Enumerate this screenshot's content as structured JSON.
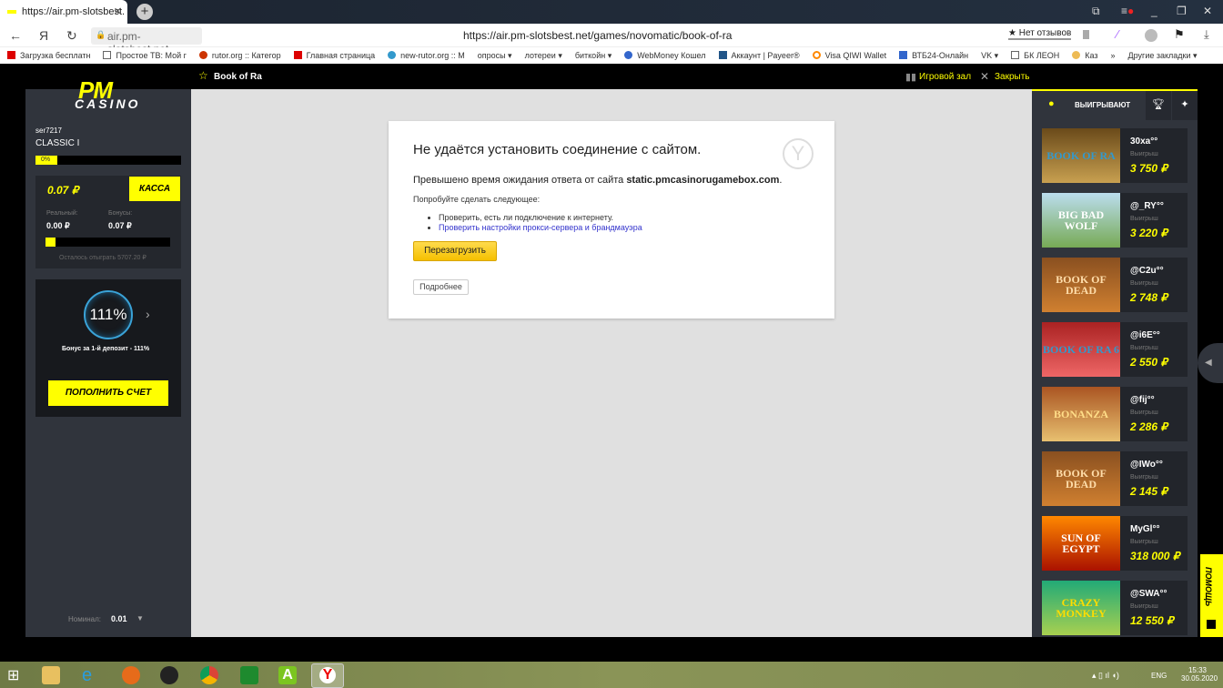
{
  "browser": {
    "tab_title": "https://air.pm-slotsbest.",
    "host": "air.pm-slotsbest.net",
    "url": "https://air.pm-slotsbest.net/games/novomatic/book-of-ra",
    "reviews": "★ Нет отзывов"
  },
  "bookmarks": [
    "Загрузка бесплатн",
    "Простое ТВ: Мой г",
    "rutor.org :: Категор",
    "Главная страница",
    "new-rutor.org :: М",
    "опросы ▾",
    "лотереи ▾",
    "биткойн ▾",
    "WebMoney Кошел",
    "Аккаунт | Payeer®",
    "Visa QIWI Wallet",
    "ВТБ24-Онлайн",
    "VK ▾",
    "БК ЛЕОН",
    "Каз",
    "»",
    "Другие закладки ▾"
  ],
  "site": {
    "game_title": "Book of Ra",
    "hall": "Игровой зал",
    "close": "Закрыть",
    "logo_pm": "PM",
    "logo_casino": "CASINO"
  },
  "user": {
    "name": "ser7217",
    "level": "CLASSIC I",
    "progress_label": "0%",
    "progress": 0
  },
  "balance": {
    "total": "0.07 ₽",
    "cashier": "КАССА",
    "real_label": "Реальный:",
    "real": "0.00 ₽",
    "bonus_label": "Бонусы:",
    "bonus": "0.07 ₽",
    "wager_progress": 0.08,
    "remaining": "Осталось отыграть 5707.20 ₽"
  },
  "promo": {
    "percent": "111%",
    "text": "Бонус за 1-й депозит - 111%",
    "deposit": "ПОПОЛНИТЬ СЧЕТ"
  },
  "nominal": {
    "label": "Номинал:",
    "value": "0.01"
  },
  "error": {
    "title": "Не удаётся установить соединение с сайтом.",
    "desc": "Превышено время ожидания ответа от сайта ",
    "host": "static.pmcasinorugamebox.com",
    "try": "Попробуйте сделать следующее:",
    "b1": "Проверить, есть ли подключение к интернету.",
    "b2": "Проверить настройки прокси-сервера и брандмауэра",
    "reload": "Перезагрузить",
    "more": "Подробнее"
  },
  "winners": {
    "tab": "ВЫИГРЫВАЮТ",
    "label": "Выигрыш",
    "items": [
      {
        "game": "BOOK OF RA",
        "user": "30xa°°",
        "amount": "3 750 ₽"
      },
      {
        "game": "BIG BAD WOLF",
        "user": "@_RY°°",
        "amount": "3 220 ₽"
      },
      {
        "game": "BOOK OF DEAD",
        "user": "@C2u°°",
        "amount": "2 748 ₽"
      },
      {
        "game": "BOOK OF RA 6",
        "user": "@i6E°°",
        "amount": "2 550 ₽"
      },
      {
        "game": "BONANZA",
        "user": "@fij°°",
        "amount": "2 286 ₽"
      },
      {
        "game": "BOOK OF DEAD",
        "user": "@IWo°°",
        "amount": "2 145 ₽"
      },
      {
        "game": "SUN OF EGYPT",
        "user": "MyGl°°",
        "amount": "318 000 ₽"
      },
      {
        "game": "CRAZY MONKEY",
        "user": "@SWA°°",
        "amount": "12 550 ₽"
      }
    ]
  },
  "help": "ПОМОЩЬ",
  "taskbar": {
    "lang": "ENG",
    "time": "15:33",
    "date": "30.05.2020"
  }
}
